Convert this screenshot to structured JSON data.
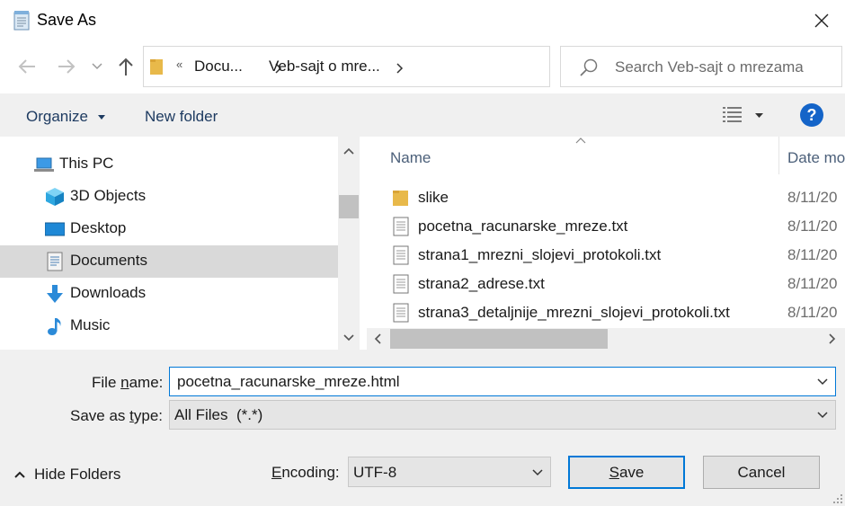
{
  "window": {
    "title": "Save As"
  },
  "address": {
    "overflow": "«",
    "crumbs": [
      "Docu...",
      "Veb-sajt o mre..."
    ]
  },
  "search": {
    "placeholder": "Search Veb-sajt o mrezama"
  },
  "toolbar": {
    "organize": "Organize",
    "new_folder": "New folder"
  },
  "nav": {
    "items": [
      {
        "label": "This PC",
        "icon": "pc-icon"
      },
      {
        "label": "3D Objects",
        "icon": "cube-icon"
      },
      {
        "label": "Desktop",
        "icon": "desktop-icon"
      },
      {
        "label": "Documents",
        "icon": "documents-icon",
        "selected": true
      },
      {
        "label": "Downloads",
        "icon": "download-icon"
      },
      {
        "label": "Music",
        "icon": "music-icon"
      }
    ]
  },
  "files": {
    "columns": {
      "name": "Name",
      "date": "Date mo"
    },
    "rows": [
      {
        "name": "slike",
        "date": "8/11/20",
        "type": "folder"
      },
      {
        "name": "pocetna_racunarske_mreze.txt",
        "date": "8/11/20",
        "type": "txt"
      },
      {
        "name": "strana1_mrezni_slojevi_protokoli.txt",
        "date": "8/11/20",
        "type": "txt"
      },
      {
        "name": "strana2_adrese.txt",
        "date": "8/11/20",
        "type": "txt"
      },
      {
        "name": "strana3_detaljnije_mrezni_slojevi_protokoli.txt",
        "date": "8/11/20",
        "type": "txt"
      }
    ]
  },
  "form": {
    "file_name_label_pre": "File ",
    "file_name_label_u": "n",
    "file_name_label_post": "ame:",
    "file_name_value": "pocetna_racunarske_mreze.html",
    "type_label_pre": "Save as ",
    "type_label_u": "t",
    "type_label_post": "ype:",
    "type_value": "All Files  (*.*)",
    "encoding_label_pre": "",
    "encoding_label_u": "E",
    "encoding_label_post": "ncoding:",
    "encoding_value": "UTF-8",
    "hide_folders": "Hide Folders",
    "save_u": "S",
    "save_post": "ave",
    "cancel": "Cancel"
  },
  "colors": {
    "accent": "#0078d7",
    "link": "#1e3b61",
    "folder": "#e8b94a",
    "help": "#1464c8"
  }
}
